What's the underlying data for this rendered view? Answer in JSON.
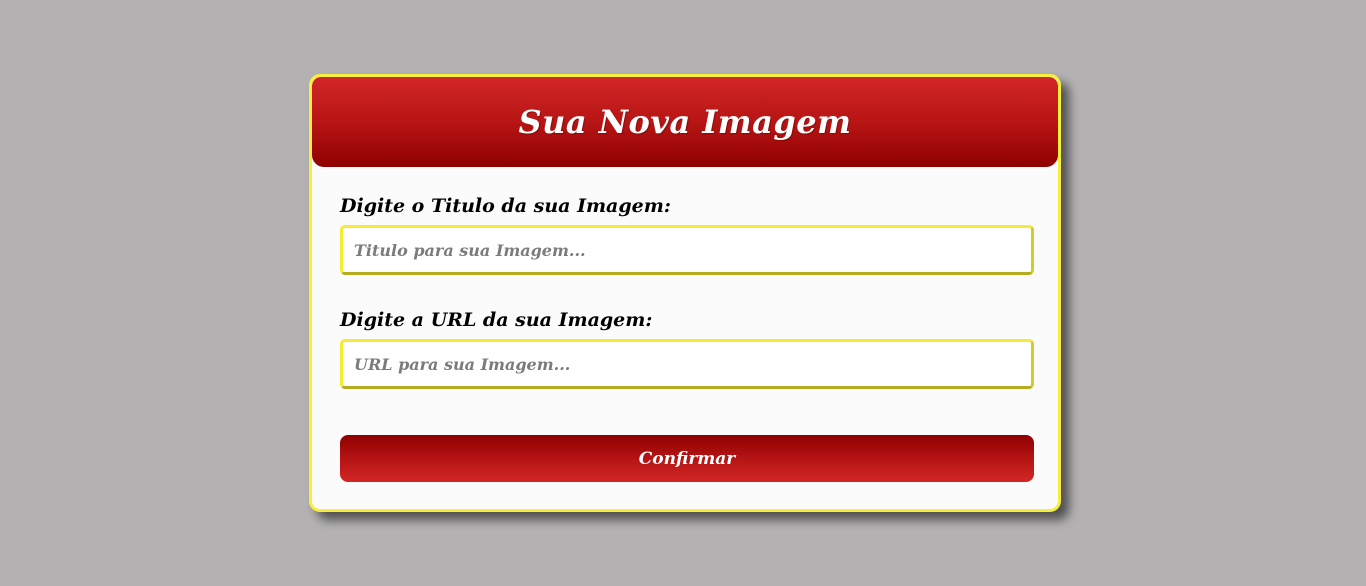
{
  "form": {
    "title": "Sua Nova Imagem",
    "title_field": {
      "label": "Digite o Titulo da sua Imagem:",
      "placeholder": "Titulo para sua Imagem...",
      "value": ""
    },
    "url_field": {
      "label": "Digite a URL da sua Imagem:",
      "placeholder": "URL para sua Imagem...",
      "value": ""
    },
    "confirm_label": "Confirmar"
  },
  "colors": {
    "background": "#b3b1b2",
    "card_border": "#f7ef3b",
    "header_red": "#b81515",
    "input_border": "#f5ea35",
    "button_red": "#b51414"
  }
}
